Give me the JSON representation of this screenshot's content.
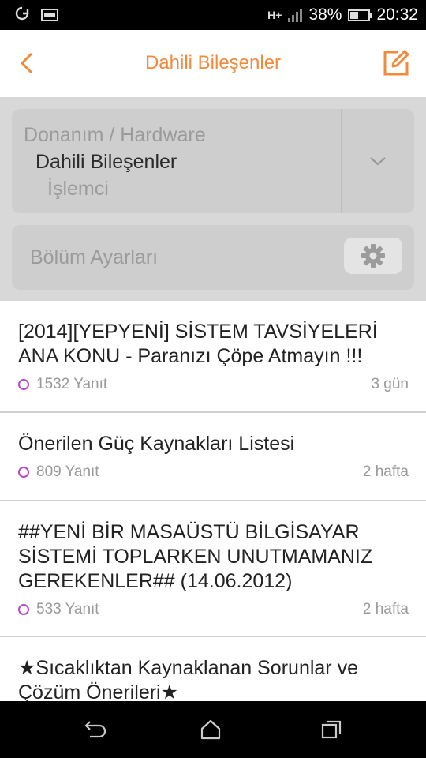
{
  "status_bar": {
    "network": "H+",
    "battery": "38%",
    "battery_level": 0.38,
    "time": "20:32",
    "left_icons": [
      "sync-icon",
      "image-icon"
    ]
  },
  "header": {
    "title": "Dahili Bileşenler",
    "back_icon": "chevron-left-icon",
    "compose_icon": "compose-icon",
    "accent_color": "#f28a3c"
  },
  "breadcrumb": {
    "level1": "Donanım / Hardware",
    "level2": "Dahili Bileşenler",
    "level3": "İşlemci",
    "dropdown_icon": "chevron-down-icon"
  },
  "section_settings": {
    "label": "Bölüm Ayarları",
    "icon": "gear-icon"
  },
  "topics": [
    {
      "title": "[2014][YEPYENİ] SİSTEM TAVSİYELERİ ANA KONU - Paranızı Çöpe Atmayın !!!",
      "replies": "1532 Yanıt",
      "time": "3 gün"
    },
    {
      "title": "Önerilen Güç Kaynakları Listesi",
      "replies": "809 Yanıt",
      "time": "2 hafta"
    },
    {
      "title": "##YENİ BİR MASAÜSTÜ BİLGİSAYAR SİSTEMİ TOPLARKEN UNUTMAMANIZ GEREKENLER## (14.06.2012)",
      "replies": "533 Yanıt",
      "time": "2 hafta"
    },
    {
      "title": "★Sıcaklıktan Kaynaklanan Sorunlar ve Çözüm Önerileri★"
    }
  ],
  "nav_bar": {
    "icons": [
      "back-arrow-icon",
      "home-icon",
      "recents-icon"
    ]
  }
}
